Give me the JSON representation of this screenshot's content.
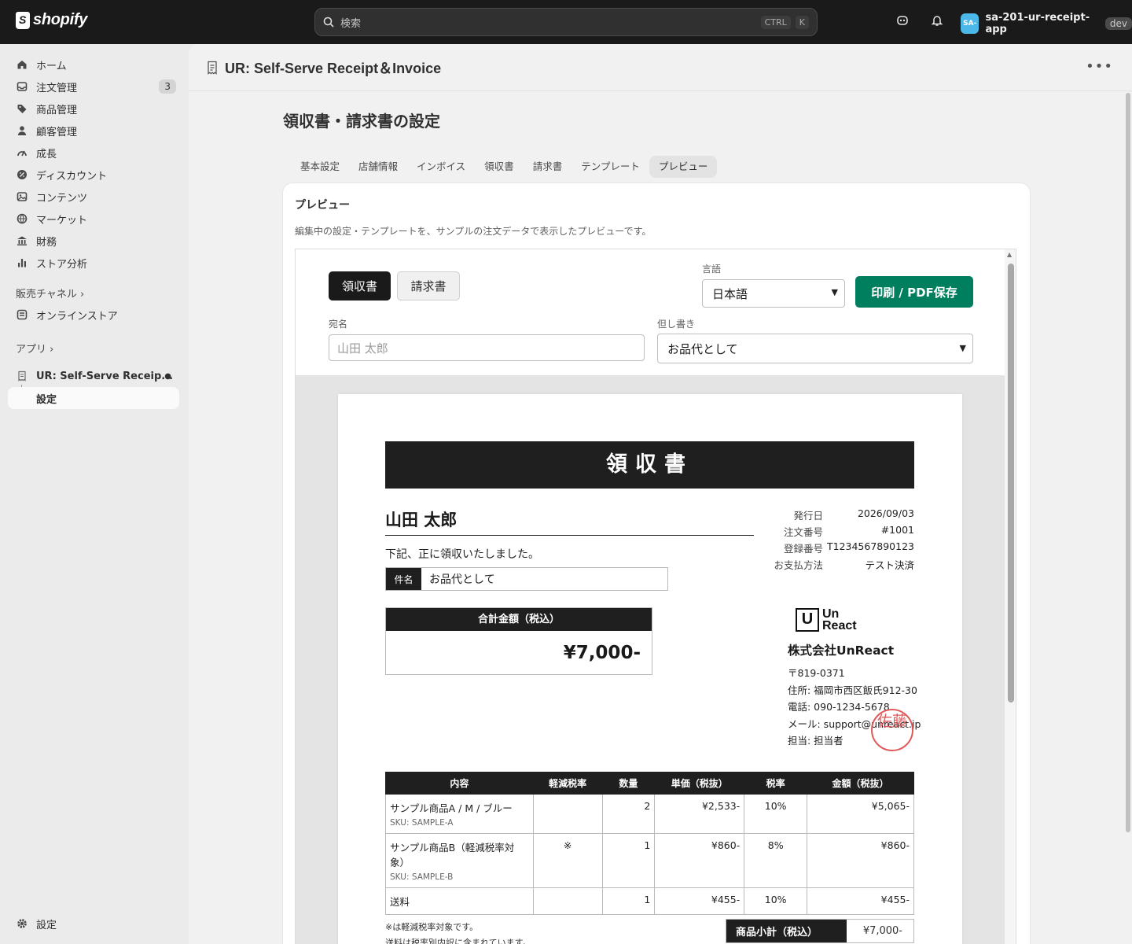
{
  "topbar": {
    "logo": "shopify",
    "search_placeholder": "検索",
    "kbd_ctrl": "CTRL",
    "kbd_k": "K",
    "store_initials": "SA-",
    "store_name": "sa-201-ur-receipt-app",
    "store_badge": "dev"
  },
  "sidebar": {
    "items": [
      {
        "label": "ホーム",
        "icon": "home-icon"
      },
      {
        "label": "注文管理",
        "icon": "inbox-icon",
        "badge": "3"
      },
      {
        "label": "商品管理",
        "icon": "tag-icon"
      },
      {
        "label": "顧客管理",
        "icon": "person-icon"
      },
      {
        "label": "成長",
        "icon": "growth-icon"
      },
      {
        "label": "ディスカウント",
        "icon": "discount-icon"
      },
      {
        "label": "コンテンツ",
        "icon": "content-icon"
      },
      {
        "label": "マーケット",
        "icon": "globe-icon"
      },
      {
        "label": "財務",
        "icon": "bank-icon"
      },
      {
        "label": "ストア分析",
        "icon": "chart-icon"
      }
    ],
    "sales_channels": "販売チャネル ›",
    "online_store": "オンラインストア",
    "apps": "アプリ ›",
    "app_item": "UR: Self-Serve Receip...",
    "app_sub": "設定",
    "settings": "設定"
  },
  "app": {
    "title": "UR: Self-Serve Receipt＆Invoice",
    "page_title": "領収書・請求書の設定",
    "tabs": [
      "基本設定",
      "店舗情報",
      "インボイス",
      "領収書",
      "請求書",
      "テンプレート",
      "プレビュー"
    ],
    "active_tab": 6,
    "card_title": "プレビュー",
    "card_desc": "編集中の設定・テンプレートを、サンプルの注文データで表示したプレビューです。"
  },
  "controls": {
    "receipt_btn": "領収書",
    "invoice_btn": "請求書",
    "language_label": "言語",
    "language_value": "日本語",
    "print_btn": "印刷 / PDF保存",
    "addressee_label": "宛名",
    "addressee_placeholder": "山田 太郎",
    "proviso_label": "但し書き",
    "proviso_value": "お品代として"
  },
  "receipt": {
    "title": "領収書",
    "recipient": "山田 太郎",
    "received_text": "下記、正に領収いたしました。",
    "subject_label": "件名",
    "subject_value": "お品代として",
    "total_label": "合計金額（税込）",
    "total_value": "¥7,000-",
    "meta": [
      {
        "k": "発行日",
        "v": "2026/09/03"
      },
      {
        "k": "注文番号",
        "v": "#1001"
      },
      {
        "k": "登録番号",
        "v": "T1234567890123"
      },
      {
        "k": "お支払方法",
        "v": "テスト決済"
      }
    ],
    "logo_text_1": "Un",
    "logo_text_2": "React",
    "company_name": "株式会社UnReact",
    "postal": "〒819-0371",
    "address": "住所: 福岡市西区飯氏912-30",
    "phone": "電話: 090-1234-5678",
    "email": "メール: support@unreact.jp",
    "staff": "担当: 担当者",
    "stamp_text": "佐藤",
    "table_headers": [
      "内容",
      "軽減税率",
      "数量",
      "単価（税抜）",
      "税率",
      "金額（税抜）"
    ],
    "rows": [
      {
        "name": "サンプル商品A / M / ブルー",
        "sku": "SKU: SAMPLE-A",
        "reduced": "",
        "qty": "2",
        "unit": "¥2,533-",
        "rate": "10%",
        "amount": "¥5,065-"
      },
      {
        "name": "サンプル商品B（軽減税率対象）",
        "sku": "SKU: SAMPLE-B",
        "reduced": "※",
        "qty": "1",
        "unit": "¥860-",
        "rate": "8%",
        "amount": "¥860-"
      },
      {
        "name": "送料",
        "sku": "",
        "reduced": "",
        "qty": "1",
        "unit": "¥455-",
        "rate": "10%",
        "amount": "¥455-"
      }
    ],
    "note_1": "※は軽減税率対象です。",
    "note_2": "送料は税率別内訳に含まれています。",
    "subtotal_label": "商品小計（税込）",
    "subtotal_value": "¥7,000-"
  }
}
